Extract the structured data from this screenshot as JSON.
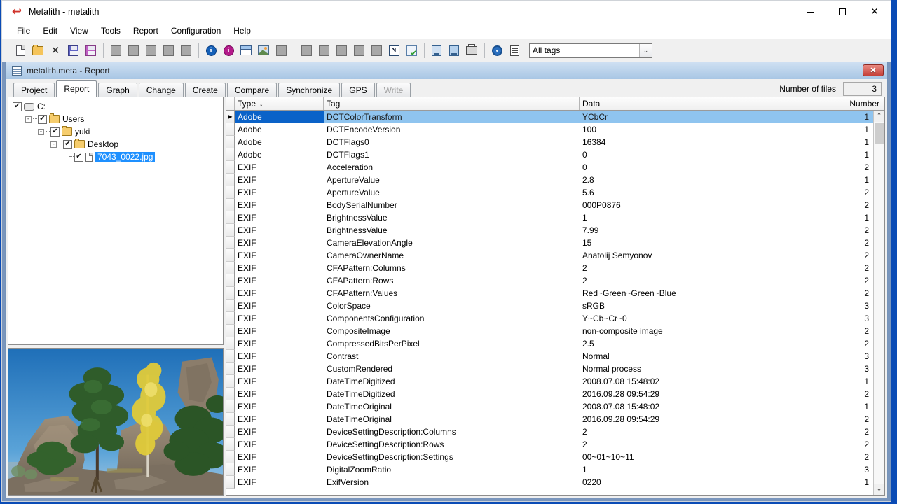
{
  "window": {
    "title": "Metalith - metalith",
    "app_icon": "metalith-flame-icon",
    "minimize": "—",
    "maximize": "□",
    "close": "✕"
  },
  "menubar": {
    "items": [
      "File",
      "Edit",
      "View",
      "Tools",
      "Report",
      "Configuration",
      "Help"
    ]
  },
  "toolbar": {
    "groups": [
      {
        "buttons": [
          {
            "name": "new-file-icon",
            "kind": "new"
          },
          {
            "name": "open-file-icon",
            "kind": "open"
          },
          {
            "name": "close-file-icon",
            "kind": "x"
          },
          {
            "name": "save-icon",
            "kind": "save"
          },
          {
            "name": "save-as-icon",
            "kind": "save-magenta"
          }
        ]
      },
      {
        "buttons": [
          {
            "name": "blank-button-1",
            "kind": "blank"
          },
          {
            "name": "blank-button-2",
            "kind": "blank"
          },
          {
            "name": "blank-button-3",
            "kind": "blank"
          },
          {
            "name": "blank-button-4",
            "kind": "blank"
          },
          {
            "name": "blank-button-5",
            "kind": "blank"
          }
        ]
      },
      {
        "buttons": [
          {
            "name": "info-blue-icon",
            "kind": "info-blue"
          },
          {
            "name": "info-magenta-icon",
            "kind": "info-magenta"
          },
          {
            "name": "window-icon",
            "kind": "window"
          },
          {
            "name": "preview-image-icon",
            "kind": "image"
          },
          {
            "name": "blank-button-6",
            "kind": "blank"
          }
        ]
      },
      {
        "buttons": [
          {
            "name": "blank-button-7",
            "kind": "blank"
          },
          {
            "name": "blank-button-8",
            "kind": "blank"
          },
          {
            "name": "blank-button-9",
            "kind": "blank"
          },
          {
            "name": "blank-button-10",
            "kind": "blank"
          },
          {
            "name": "blank-button-11",
            "kind": "blank"
          },
          {
            "name": "n-letter-icon",
            "kind": "n"
          },
          {
            "name": "check-list-icon",
            "kind": "check"
          }
        ]
      },
      {
        "buttons": [
          {
            "name": "report-export-icon",
            "kind": "doc-blue"
          },
          {
            "name": "report-save-icon",
            "kind": "doc-blue2"
          },
          {
            "name": "print-icon",
            "kind": "print"
          }
        ]
      },
      {
        "buttons": [
          {
            "name": "settings-gear-icon",
            "kind": "gear"
          },
          {
            "name": "tag-list-icon",
            "kind": "list"
          }
        ]
      }
    ],
    "tag_filter": {
      "value": "All tags",
      "arrow": "⌄"
    }
  },
  "child_window": {
    "title": "metalith.meta - Report",
    "icon": "grid-window-icon",
    "close_label": "✖"
  },
  "tabs": [
    {
      "label": "Project",
      "active": false,
      "disabled": false
    },
    {
      "label": "Report",
      "active": true,
      "disabled": false
    },
    {
      "label": "Graph",
      "active": false,
      "disabled": false
    },
    {
      "label": "Change",
      "active": false,
      "disabled": false
    },
    {
      "label": "Create",
      "active": false,
      "disabled": false
    },
    {
      "label": "Compare",
      "active": false,
      "disabled": false
    },
    {
      "label": "Synchronize",
      "active": false,
      "disabled": false
    },
    {
      "label": "GPS",
      "active": false,
      "disabled": false
    },
    {
      "label": "Write",
      "active": false,
      "disabled": true
    }
  ],
  "files_counter": {
    "label": "Number of files",
    "value": "3"
  },
  "tree": {
    "nodes": [
      {
        "label": "C:",
        "indent": 0,
        "expander": "",
        "icon": "drive",
        "checked": true,
        "selected": false
      },
      {
        "label": "Users",
        "indent": 1,
        "expander": "-",
        "icon": "folder",
        "checked": true,
        "selected": false
      },
      {
        "label": "yuki",
        "indent": 2,
        "expander": "-",
        "icon": "folder",
        "checked": true,
        "selected": false
      },
      {
        "label": "Desktop",
        "indent": 3,
        "expander": "-",
        "icon": "folder",
        "checked": true,
        "selected": false
      },
      {
        "label": "7043_0022.jpg",
        "indent": 4,
        "expander": "",
        "icon": "file",
        "checked": true,
        "selected": true
      }
    ],
    "check_glyph": "✔"
  },
  "photo": {
    "alt": "autumn rocky outcrop with pine trees and yellow birch under blue sky",
    "sky_color": "#2f83c8",
    "rock_color": "#8e7f6c",
    "pine_color": "#2d5a28",
    "birch_color": "#ddc936"
  },
  "grid": {
    "columns": [
      {
        "key": "type",
        "label": "Type",
        "sorted": true,
        "sort_arrow": "↓"
      },
      {
        "key": "tag",
        "label": "Tag",
        "sorted": false,
        "sort_arrow": ""
      },
      {
        "key": "data",
        "label": "Data",
        "sorted": false,
        "sort_arrow": ""
      },
      {
        "key": "number",
        "label": "Number",
        "sorted": false,
        "sort_arrow": ""
      }
    ],
    "selected_marker": "▶",
    "scrollbar": {
      "up": "⌃",
      "down": "⌄"
    },
    "rows": [
      {
        "type": "Adobe",
        "tag": "DCTColorTransform",
        "data": "YCbCr",
        "number": "1",
        "selected": true
      },
      {
        "type": "Adobe",
        "tag": "DCTEncodeVersion",
        "data": "100",
        "number": "1",
        "selected": false
      },
      {
        "type": "Adobe",
        "tag": "DCTFlags0",
        "data": "16384",
        "number": "1",
        "selected": false
      },
      {
        "type": "Adobe",
        "tag": "DCTFlags1",
        "data": "0",
        "number": "1",
        "selected": false
      },
      {
        "type": "EXIF",
        "tag": "Acceleration",
        "data": "0",
        "number": "2",
        "selected": false
      },
      {
        "type": "EXIF",
        "tag": "ApertureValue",
        "data": "2.8",
        "number": "1",
        "selected": false
      },
      {
        "type": "EXIF",
        "tag": "ApertureValue",
        "data": "5.6",
        "number": "2",
        "selected": false
      },
      {
        "type": "EXIF",
        "tag": "BodySerialNumber",
        "data": "000P0876",
        "number": "2",
        "selected": false
      },
      {
        "type": "EXIF",
        "tag": "BrightnessValue",
        "data": "1",
        "number": "1",
        "selected": false
      },
      {
        "type": "EXIF",
        "tag": "BrightnessValue",
        "data": "7.99",
        "number": "2",
        "selected": false
      },
      {
        "type": "EXIF",
        "tag": "CameraElevationAngle",
        "data": "15",
        "number": "2",
        "selected": false
      },
      {
        "type": "EXIF",
        "tag": "CameraOwnerName",
        "data": "Anatolij Semyonov",
        "number": "2",
        "selected": false
      },
      {
        "type": "EXIF",
        "tag": "CFAPattern:Columns",
        "data": "2",
        "number": "2",
        "selected": false
      },
      {
        "type": "EXIF",
        "tag": "CFAPattern:Rows",
        "data": "2",
        "number": "2",
        "selected": false
      },
      {
        "type": "EXIF",
        "tag": "CFAPattern:Values",
        "data": "Red~Green~Green~Blue",
        "number": "2",
        "selected": false
      },
      {
        "type": "EXIF",
        "tag": "ColorSpace",
        "data": "sRGB",
        "number": "3",
        "selected": false
      },
      {
        "type": "EXIF",
        "tag": "ComponentsConfiguration",
        "data": "Y~Cb~Cr~0",
        "number": "3",
        "selected": false
      },
      {
        "type": "EXIF",
        "tag": "CompositeImage",
        "data": "non-composite image",
        "number": "2",
        "selected": false
      },
      {
        "type": "EXIF",
        "tag": "CompressedBitsPerPixel",
        "data": "2.5",
        "number": "2",
        "selected": false
      },
      {
        "type": "EXIF",
        "tag": "Contrast",
        "data": "Normal",
        "number": "3",
        "selected": false
      },
      {
        "type": "EXIF",
        "tag": "CustomRendered",
        "data": "Normal process",
        "number": "3",
        "selected": false
      },
      {
        "type": "EXIF",
        "tag": "DateTimeDigitized",
        "data": "2008.07.08 15:48:02",
        "number": "1",
        "selected": false
      },
      {
        "type": "EXIF",
        "tag": "DateTimeDigitized",
        "data": "2016.09.28 09:54:29",
        "number": "2",
        "selected": false
      },
      {
        "type": "EXIF",
        "tag": "DateTimeOriginal",
        "data": "2008.07.08 15:48:02",
        "number": "1",
        "selected": false
      },
      {
        "type": "EXIF",
        "tag": "DateTimeOriginal",
        "data": "2016.09.28 09:54:29",
        "number": "2",
        "selected": false
      },
      {
        "type": "EXIF",
        "tag": "DeviceSettingDescription:Columns",
        "data": "2",
        "number": "2",
        "selected": false
      },
      {
        "type": "EXIF",
        "tag": "DeviceSettingDescription:Rows",
        "data": "2",
        "number": "2",
        "selected": false
      },
      {
        "type": "EXIF",
        "tag": "DeviceSettingDescription:Settings",
        "data": "00~01~10~11",
        "number": "2",
        "selected": false
      },
      {
        "type": "EXIF",
        "tag": "DigitalZoomRatio",
        "data": "1",
        "number": "3",
        "selected": false
      },
      {
        "type": "EXIF",
        "tag": "ExifVersion",
        "data": "0220",
        "number": "1",
        "selected": false
      }
    ]
  }
}
